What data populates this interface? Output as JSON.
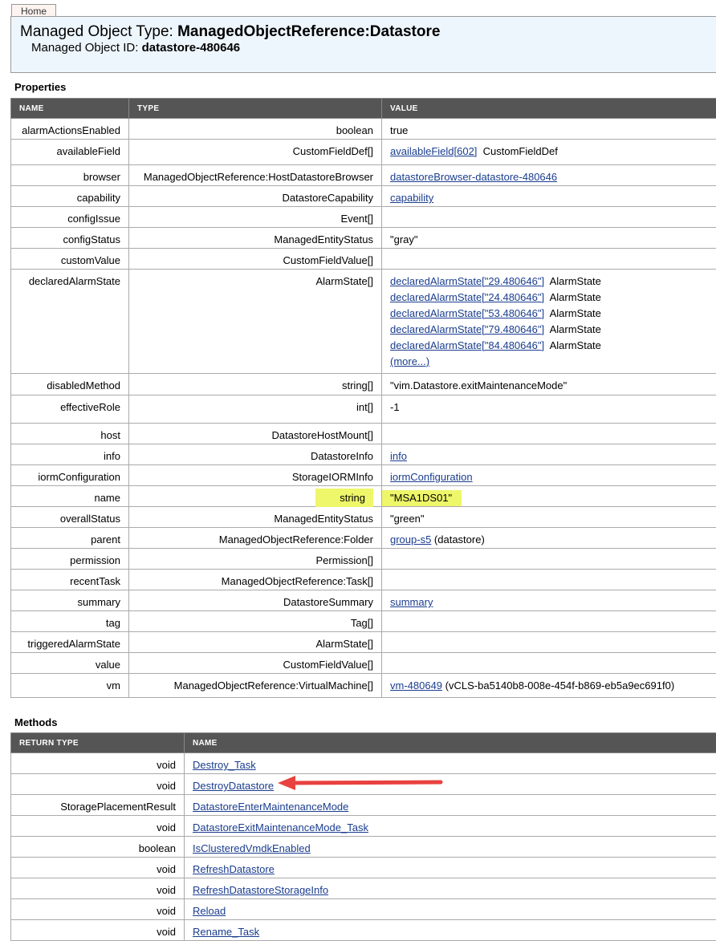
{
  "nav": {
    "home": "Home"
  },
  "header": {
    "type_label": "Managed Object Type: ",
    "type_value": "ManagedObjectReference:Datastore",
    "id_label": "Managed Object ID: ",
    "id_value": "datastore-480646"
  },
  "properties": {
    "title": "Properties",
    "columns": [
      "NAME",
      "TYPE",
      "VALUE"
    ],
    "rows": [
      {
        "name": "alarmActionsEnabled",
        "type": "boolean",
        "value": [
          [
            {
              "t": "true"
            }
          ]
        ]
      },
      {
        "name": "availableField",
        "type": "CustomFieldDef[]",
        "value": [
          [
            {
              "l": "availableField[602]"
            },
            {
              "t": "  CustomFieldDef"
            }
          ]
        ]
      },
      {
        "name": "browser",
        "type": "ManagedObjectReference:HostDatastoreBrowser",
        "value": [
          [
            {
              "l": "datastoreBrowser-datastore-480646"
            }
          ]
        ]
      },
      {
        "name": "capability",
        "type": "DatastoreCapability",
        "value": [
          [
            {
              "l": "capability"
            }
          ]
        ]
      },
      {
        "name": "configIssue",
        "type": "Event[]",
        "value": []
      },
      {
        "name": "configStatus",
        "type": "ManagedEntityStatus",
        "value": [
          [
            {
              "t": "\"gray\""
            }
          ]
        ]
      },
      {
        "name": "customValue",
        "type": "CustomFieldValue[]",
        "value": []
      },
      {
        "name": "declaredAlarmState",
        "type": "AlarmState[]",
        "value": [
          [
            {
              "l": "declaredAlarmState[\"29.480646\"]"
            },
            {
              "t": "  AlarmState"
            }
          ],
          [
            {
              "l": "declaredAlarmState[\"24.480646\"]"
            },
            {
              "t": "  AlarmState"
            }
          ],
          [
            {
              "l": "declaredAlarmState[\"53.480646\"]"
            },
            {
              "t": "  AlarmState"
            }
          ],
          [
            {
              "l": "declaredAlarmState[\"79.480646\"]"
            },
            {
              "t": "  AlarmState"
            }
          ],
          [
            {
              "l": "declaredAlarmState[\"84.480646\"]"
            },
            {
              "t": "  AlarmState"
            }
          ],
          [
            {
              "l": "(more...)"
            }
          ]
        ]
      },
      {
        "name": "disabledMethod",
        "type": "string[]",
        "value": [
          [
            {
              "t": "\"vim.Datastore.exitMaintenanceMode\""
            }
          ]
        ]
      },
      {
        "name": "effectiveRole",
        "type": "int[]",
        "value": [
          [
            {
              "t": "-1"
            }
          ]
        ]
      },
      {
        "name": "host",
        "type": "DatastoreHostMount[]",
        "value": []
      },
      {
        "name": "info",
        "type": "DatastoreInfo",
        "value": [
          [
            {
              "l": "info"
            }
          ]
        ]
      },
      {
        "name": "iormConfiguration",
        "type": "StorageIORMInfo",
        "value": [
          [
            {
              "l": "iormConfiguration"
            }
          ]
        ]
      },
      {
        "name": "name",
        "type": "string",
        "value": [
          [
            {
              "t": "\"MSA1DS01\""
            }
          ]
        ],
        "highlight": true
      },
      {
        "name": "overallStatus",
        "type": "ManagedEntityStatus",
        "value": [
          [
            {
              "t": "\"green\""
            }
          ]
        ]
      },
      {
        "name": "parent",
        "type": "ManagedObjectReference:Folder",
        "value": [
          [
            {
              "l": "group-s5"
            },
            {
              "t": " (datastore)"
            }
          ]
        ]
      },
      {
        "name": "permission",
        "type": "Permission[]",
        "value": []
      },
      {
        "name": "recentTask",
        "type": "ManagedObjectReference:Task[]",
        "value": []
      },
      {
        "name": "summary",
        "type": "DatastoreSummary",
        "value": [
          [
            {
              "l": "summary"
            }
          ]
        ]
      },
      {
        "name": "tag",
        "type": "Tag[]",
        "value": []
      },
      {
        "name": "triggeredAlarmState",
        "type": "AlarmState[]",
        "value": []
      },
      {
        "name": "value",
        "type": "CustomFieldValue[]",
        "value": []
      },
      {
        "name": "vm",
        "type": "ManagedObjectReference:VirtualMachine[]",
        "value": [
          [
            {
              "l": "vm-480649"
            },
            {
              "t": " (vCLS-ba5140b8-008e-454f-b869-eb5a9ec691f0)"
            }
          ]
        ]
      }
    ]
  },
  "methods": {
    "title": "Methods",
    "columns": [
      "RETURN TYPE",
      "NAME"
    ],
    "rows": [
      {
        "ret": "void",
        "name": "Destroy_Task"
      },
      {
        "ret": "void",
        "name": "DestroyDatastore"
      },
      {
        "ret": "StoragePlacementResult",
        "name": "DatastoreEnterMaintenanceMode"
      },
      {
        "ret": "void",
        "name": "DatastoreExitMaintenanceMode_Task"
      },
      {
        "ret": "boolean",
        "name": "IsClusteredVmdkEnabled"
      },
      {
        "ret": "void",
        "name": "RefreshDatastore"
      },
      {
        "ret": "void",
        "name": "RefreshDatastoreStorageInfo"
      },
      {
        "ret": "void",
        "name": "Reload"
      },
      {
        "ret": "void",
        "name": "Rename_Task"
      }
    ]
  },
  "colors": {
    "header_bg": "#555555",
    "highlight": "#eef66a",
    "arrow": "#e8413f",
    "link": "#1a3d8f"
  }
}
